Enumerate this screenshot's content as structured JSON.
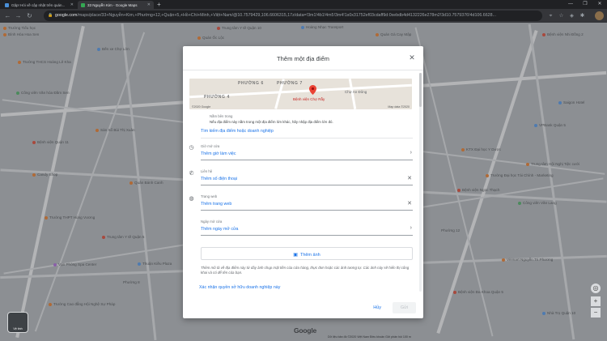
{
  "browser": {
    "tabs": [
      {
        "label": "Gặp! Hỏi về cập nhật trên quán...",
        "active": false
      },
      {
        "label": "33 Nguyễn Kim - Google Maps",
        "active": true
      }
    ],
    "new_tab_icon": "plus-icon",
    "url_host": "google.com",
    "url_rest": "/maps/place/33+Nguyễn+Kim,+Phường+12,+Quận+5,+Hồ+Chí+Minh,+Việt+Nam/@10.7579429,106.6606315,17z/data=!3m1!4b1!4m5!3m4!1s0x31752ef03cdaff9d:0xebdb4d4132226e278m2!3d10.7579376!4d106.6628..."
  },
  "map": {
    "labels": [
      {
        "text": "Trường Tiểu học",
        "pin": "o"
      },
      {
        "text": "Bình Hòa Hoa Sen",
        "pin": "o"
      },
      {
        "text": "Trường THCS Hoàng Lê Kha",
        "pin": "o"
      },
      {
        "text": "Trung tâm Y tế Quận 10",
        "pin": "r"
      },
      {
        "text": "Quán Ốc Lộc",
        "pin": "o"
      },
      {
        "text": "Hoàng Nhạc Transport",
        "pin": "b"
      },
      {
        "text": "Quán Gà Cay Mập",
        "pin": "o"
      },
      {
        "text": "Bến xe Chợ Lớn",
        "pin": "b"
      },
      {
        "text": "Bệnh viện Quận 11",
        "pin": "r"
      },
      {
        "text": "Công viên Văn hóa Đầm Sen",
        "pin": "g"
      },
      {
        "text": "Sàn Sổ Bùi Thị Xuân",
        "pin": "o"
      },
      {
        "text": "Candy Shop",
        "pin": "o"
      },
      {
        "text": "Trường THPT Hùng Vương",
        "pin": "o"
      },
      {
        "text": "Trung tâm Y tế Quận 5",
        "pin": "r"
      },
      {
        "text": "Vạn Phòng Spa Center",
        "pin": "p"
      },
      {
        "text": "Thuận Kiều Plaza",
        "pin": "b"
      },
      {
        "text": "Trường Cao đẳng Hội Nghệ Sự Pháp",
        "pin": "o"
      },
      {
        "text": "Quân Bánh Canh",
        "pin": "o"
      },
      {
        "text": "Bệnh viện Nhi Đồng 2",
        "pin": "r"
      },
      {
        "text": "KTX Đại học Y Dược",
        "pin": "o"
      },
      {
        "text": "Trường Đại học Tài Chính - Marketing",
        "pin": "o"
      },
      {
        "text": "Công viên Văn Lang",
        "pin": "g"
      },
      {
        "text": "Trung tâm Hội Nghị Tiệc cưới",
        "pin": "o"
      },
      {
        "text": "Bệnh viện Ngọc Thạch",
        "pin": "r"
      },
      {
        "text": "VPBank Quận 5",
        "pin": "b"
      },
      {
        "text": "Vinmart Nguyễn Tri Phương",
        "pin": "o"
      },
      {
        "text": "Bệnh viện Đa Khoa Quận 5",
        "pin": "r"
      },
      {
        "text": "Nhà Trọ Quận 10",
        "pin": "b"
      },
      {
        "text": "Phường 12",
        "pin": ""
      },
      {
        "text": "Phường 8",
        "pin": ""
      },
      {
        "text": "Saigon Hotel",
        "pin": "b"
      },
      {
        "text": "Vạn Hạnh Mall",
        "pin": "o"
      }
    ],
    "logo": "Google",
    "layer_label": "Vệ tinh",
    "footer": "Dữ liệu bản đồ ©2020   Việt Nam   Điều khoản   Gửi phản hồi   100 m"
  },
  "modal": {
    "title": "Thêm một địa điểm",
    "thumb": {
      "labels": [
        "PHƯỜNG 6",
        "PHƯỜNG 7",
        "PHƯỜNG 4",
        "Bệnh viện Chợ Rẫy",
        "Chợ An Đông"
      ],
      "copyright_left": "©2020 Google",
      "copyright_right": "Map data ©2020"
    },
    "category_label": "Nằm bên trong",
    "category_desc": "Nếu địa điểm này nằm trong một địa điểm lớn khác, hãy nhập địa điểm lớn đó.",
    "search_business_link": "Tìm kiếm địa điểm hoặc doanh nghiệp",
    "hours_label": "Giờ mở cửa",
    "hours_value": "Thêm giờ làm việc",
    "phone_label": "Liên hệ",
    "phone_value": "Thêm số điện thoại",
    "website_label": "Trang web",
    "website_value": "Thêm trang web",
    "opening_label": "Ngày mở cửa",
    "opening_value": "Thêm ngày mở cửa",
    "photo_button": "Thêm ảnh",
    "disclaimer": "Thêm mô tả về địa điểm này từ dây ảnh chụp mặt tiền của cửa hàng, thực đơn hoặc các ảnh tương tự. Các ảnh này sẽ hiển thị công khai và có để tên của bạn.",
    "claim_link": "Xác nhận quyền sở hữu doanh nghiệp này",
    "cancel_label": "Hủy",
    "submit_label": "Gửi"
  }
}
